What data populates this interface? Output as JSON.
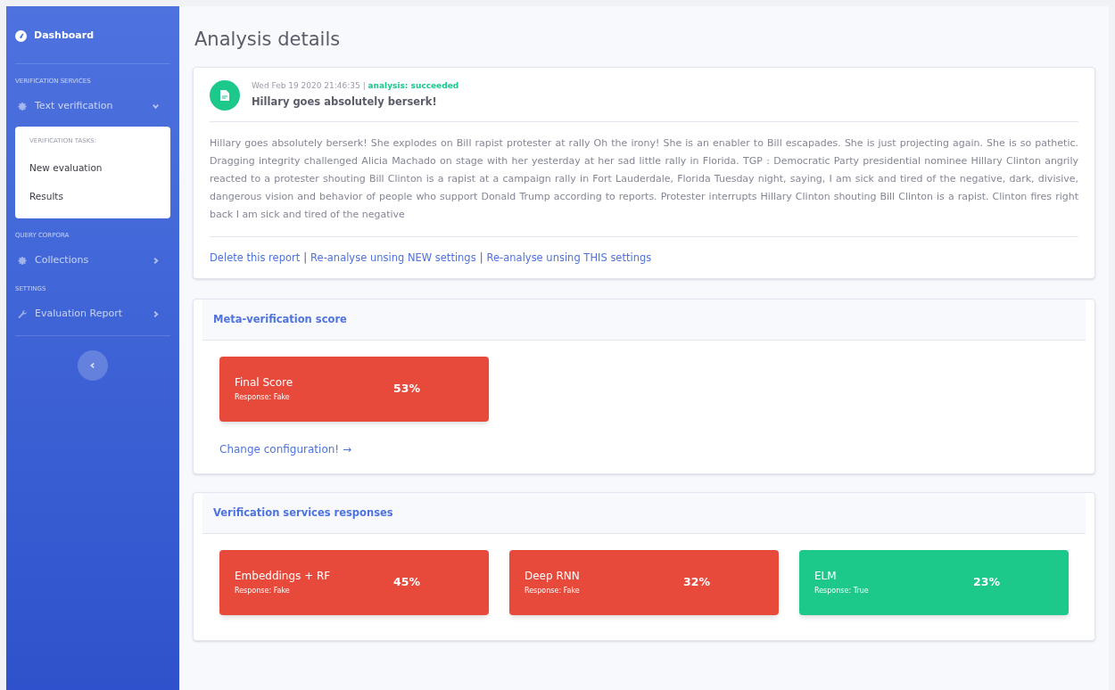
{
  "sidebar": {
    "brand": "Dashboard",
    "sections": [
      {
        "heading": "VERIFICATION SERVICES",
        "items": [
          {
            "label": "Text verification",
            "expanded": true,
            "submenu": {
              "heading": "VERIFICATION TASKS:",
              "items": [
                "New evaluation",
                "Results"
              ]
            }
          }
        ]
      },
      {
        "heading": "QUERY CORPORA",
        "items": [
          {
            "label": "Collections",
            "expanded": false
          }
        ]
      },
      {
        "heading": "SETTINGS",
        "items": [
          {
            "label": "Evaluation Report",
            "expanded": false
          }
        ]
      }
    ]
  },
  "page_title": "Analysis details",
  "report": {
    "date": "Wed Feb 19 2020 21:46:35",
    "separator": "|",
    "status": "analysis: succeeded",
    "title": "Hillary goes absolutely berserk!",
    "body": "Hillary goes absolutely berserk! She explodes on Bill rapist protester at rally Oh the irony! She is an enabler to Bill escapades. She is just projecting again. She is so pathetic. Dragging integrity challenged Alicia Machado on stage with her yesterday at her sad little rally in Florida. TGP : Democratic Party presidential nominee Hillary Clinton angrily reacted to a protester shouting Bill Clinton is a rapist at a campaign rally in Fort Lauderdale, Florida Tuesday night, saying, I am sick and tired of the negative, dark, divisive, dangerous vision and behavior of people who support Donald Trump according to reports. Protester interrupts Hillary Clinton shouting Bill Clinton is a rapist. Clinton fires right back I am sick and tired of the negative",
    "actions": [
      "Delete this report",
      "Re-analyse unsing NEW settings",
      "Re-analyse unsing THIS settings"
    ],
    "action_separator": "|"
  },
  "meta": {
    "title": "Meta-verification score",
    "scores": [
      {
        "name": "Final Score",
        "response": "Response: Fake",
        "value": "53%",
        "color": "#e74a3b"
      }
    ],
    "link": "Change configuration! →"
  },
  "services": {
    "title": "Verification services responses",
    "scores": [
      {
        "name": "Embeddings + RF",
        "response": "Response: Fake",
        "value": "45%",
        "color": "#e74a3b"
      },
      {
        "name": "Deep RNN",
        "response": "Response: Fake",
        "value": "32%",
        "color": "#e74a3b"
      },
      {
        "name": "ELM",
        "response": "Response: True",
        "value": "23%",
        "color": "#1cc88a"
      }
    ]
  }
}
